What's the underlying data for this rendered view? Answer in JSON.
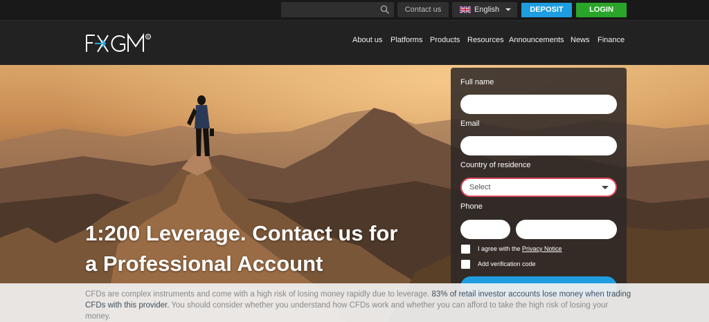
{
  "topbar": {
    "search": {
      "value": "",
      "placeholder": ""
    },
    "contact_label": "Contact us",
    "language_label": "English",
    "deposit_label": "DEPOSIT",
    "login_label": "LOGIN"
  },
  "header": {
    "logo_text": "FXGM",
    "nav": [
      {
        "label": "About us"
      },
      {
        "label": "Platforms"
      },
      {
        "label": "Products"
      },
      {
        "label": "Resources"
      },
      {
        "label": "Announcements"
      },
      {
        "label": "News"
      },
      {
        "label": "Finance"
      }
    ]
  },
  "hero": {
    "headline_line1": "1:200 Leverage. Contact us for",
    "headline_line2": "a Professional Account"
  },
  "form": {
    "full_name_label": "Full name",
    "full_name_value": "",
    "email_label": "Email",
    "email_value": "",
    "country_label": "Country of residence",
    "country_selected": "Select",
    "phone_label": "Phone",
    "phone_code_value": "",
    "phone_number_value": "",
    "agree_prefix": "I agree with the ",
    "agree_link": "Privacy Notice",
    "verification_label": "Add verification code"
  },
  "risk_warning": {
    "text_a": "CFDs are complex instruments and come with a high risk of losing money rapidly due to leverage. ",
    "text_strong": "83% of retail investor accounts lose money when trading CFDs with this provider.",
    "text_b": " You should consider whether you understand how CFDs work and whether you can afford to take the high risk of losing your money."
  },
  "colors": {
    "deposit": "#1e9ee0",
    "login": "#2aa52a",
    "select_border": "#e0455a"
  },
  "icons": {
    "search": "search-icon",
    "flag": "uk-flag-icon",
    "dropdown": "chevron-down-icon"
  }
}
